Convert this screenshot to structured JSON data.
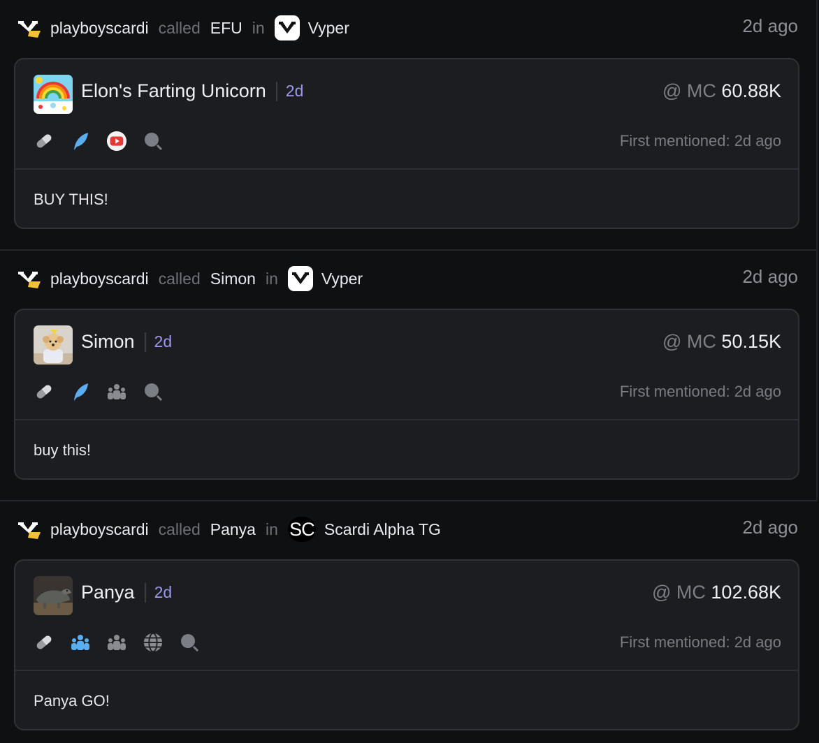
{
  "calls": [
    {
      "caller": "playboyscardi",
      "called_word": "called",
      "coin": "EFU",
      "in_word": "in",
      "source": "Vyper",
      "source_logo": "vyper-logo",
      "time": "2d ago",
      "token_name": "Elon's Farting Unicorn",
      "token_image": "unicorn-rainbow-image",
      "age": "2d",
      "mc_prefix": "@ MC",
      "mc_value": "60.88K",
      "icons": [
        "pill-icon",
        "feather-icon",
        "youtube-icon",
        "search-icon"
      ],
      "first_mentioned": "First mentioned: 2d ago",
      "message": "BUY THIS!"
    },
    {
      "caller": "playboyscardi",
      "called_word": "called",
      "coin": "Simon",
      "in_word": "in",
      "source": "Vyper",
      "source_logo": "vyper-logo",
      "time": "2d ago",
      "token_name": "Simon",
      "token_image": "dog-in-hoodie-image",
      "age": "2d",
      "mc_prefix": "@ MC",
      "mc_value": "50.15K",
      "icons": [
        "pill-icon",
        "feather-icon",
        "community-icon",
        "search-icon"
      ],
      "first_mentioned": "First mentioned: 2d ago",
      "message": "buy this!"
    },
    {
      "caller": "playboyscardi",
      "called_word": "called",
      "coin": "Panya",
      "in_word": "in",
      "source": "Scardi Alpha TG",
      "source_logo": "SC",
      "time": "2d ago",
      "token_name": "Panya",
      "token_image": "komodo-dragon-image",
      "age": "2d",
      "mc_prefix": "@ MC",
      "mc_value": "102.68K",
      "icons": [
        "pill-icon",
        "community-icon",
        "community-icon",
        "globe-icon",
        "search-icon"
      ],
      "first_mentioned": "First mentioned: 2d ago",
      "message": "Panya GO!"
    }
  ],
  "colors": {
    "background": "#0f1012",
    "card": "#1c1d20",
    "age_accent": "#9e97ee",
    "twitter_blue": "#5aaef0",
    "muted_icon": "#8a8c92"
  }
}
